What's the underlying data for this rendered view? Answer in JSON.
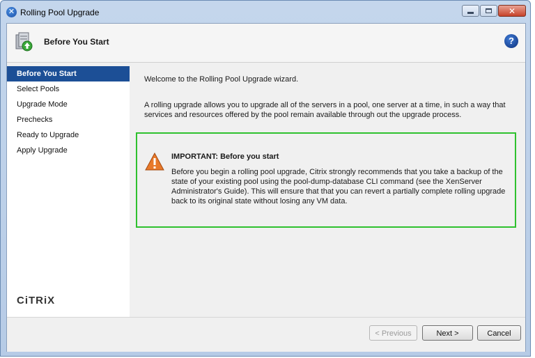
{
  "window": {
    "title": "Rolling Pool Upgrade",
    "minimize_icon": "minimize-icon",
    "maximize_icon": "maximize-icon",
    "close_icon": "close-icon",
    "close_glyph": "✕"
  },
  "header": {
    "title": "Before You Start",
    "help_glyph": "?"
  },
  "sidebar": {
    "steps": [
      {
        "label": "Before You Start",
        "active": true
      },
      {
        "label": "Select Pools",
        "active": false
      },
      {
        "label": "Upgrade Mode",
        "active": false
      },
      {
        "label": "Prechecks",
        "active": false
      },
      {
        "label": "Ready to Upgrade",
        "active": false
      },
      {
        "label": "Apply Upgrade",
        "active": false
      }
    ],
    "logo_text": "CiTRiX"
  },
  "content": {
    "welcome": "Welcome to the Rolling Pool Upgrade wizard.",
    "description": "A rolling upgrade allows you to upgrade all of the servers in a pool, one server at a time, in such a way that services and resources offered by the pool remain available through out the upgrade process.",
    "important_title": "IMPORTANT: Before you start",
    "important_text": "Before you begin a rolling pool upgrade, Citrix strongly recommends that you take a backup of the state of your existing pool using the pool-dump-database CLI command (see the XenServer Administrator's Guide). This will ensure that that you can revert a partially complete rolling upgrade back to its original state without losing any VM data."
  },
  "footer": {
    "previous_label": "< Previous",
    "next_label": "Next >",
    "cancel_label": "Cancel"
  },
  "colors": {
    "active_step": "#1c4f96",
    "important_border": "#2ec12e",
    "warning_icon": "#e8792a"
  }
}
